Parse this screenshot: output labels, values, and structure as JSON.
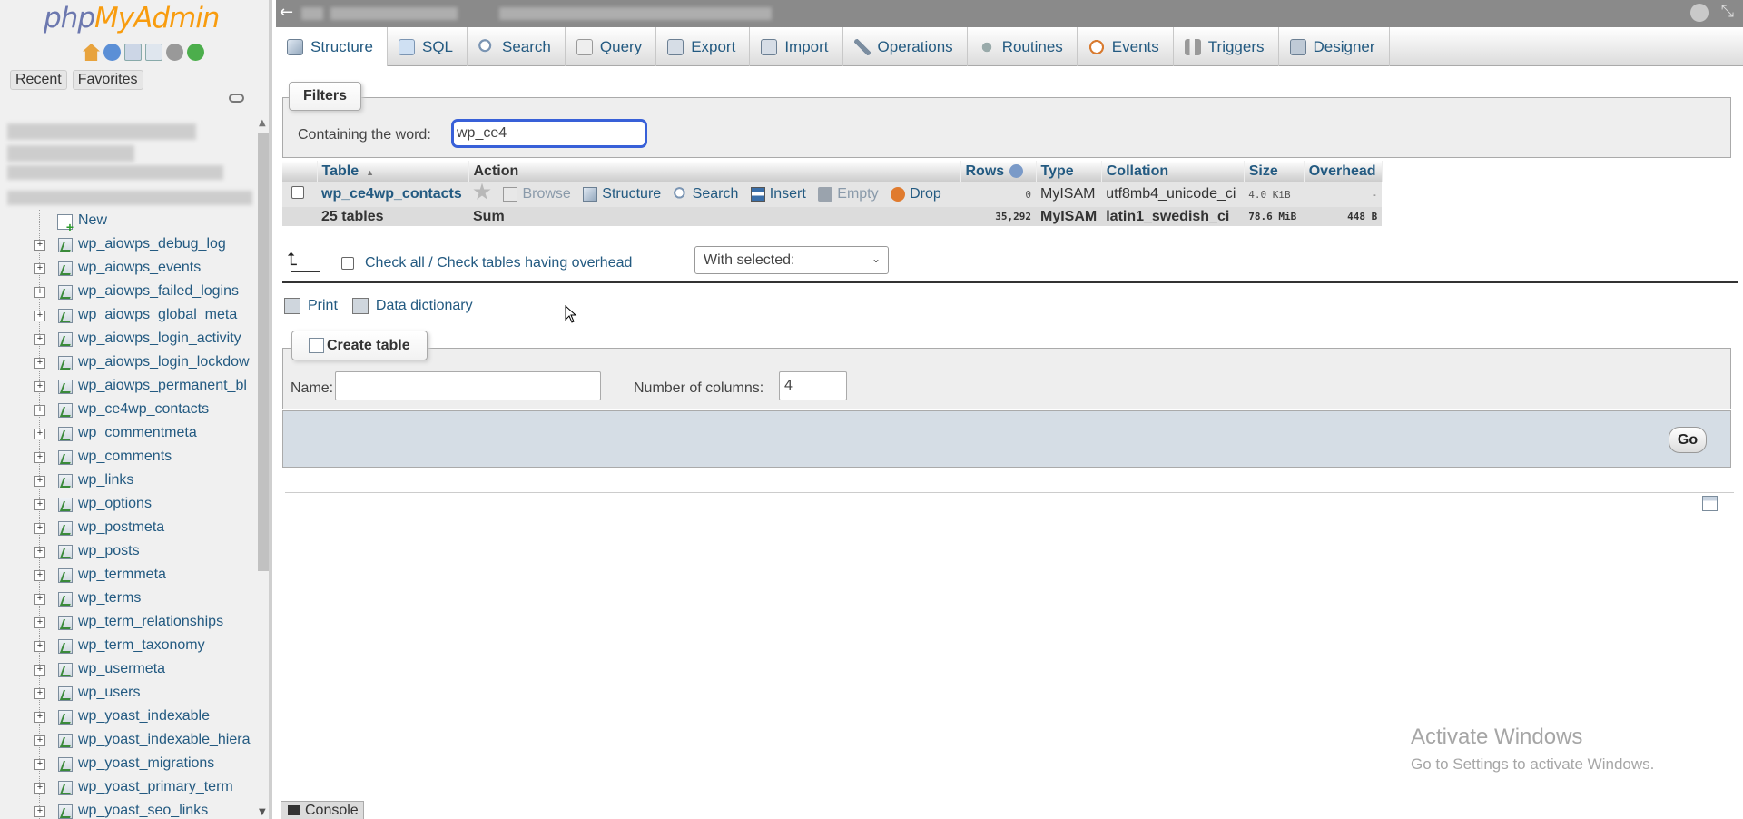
{
  "nav": {
    "logo_php": "php",
    "logo_myadmin": "MyAdmin",
    "recent": "Recent",
    "favorites": "Favorites",
    "new_label": "New",
    "tables": [
      "wp_aiowps_debug_log",
      "wp_aiowps_events",
      "wp_aiowps_failed_logins",
      "wp_aiowps_global_meta",
      "wp_aiowps_login_activity",
      "wp_aiowps_login_lockdow",
      "wp_aiowps_permanent_bl",
      "wp_ce4wp_contacts",
      "wp_commentmeta",
      "wp_comments",
      "wp_links",
      "wp_options",
      "wp_postmeta",
      "wp_posts",
      "wp_termmeta",
      "wp_terms",
      "wp_term_relationships",
      "wp_term_taxonomy",
      "wp_usermeta",
      "wp_users",
      "wp_yoast_indexable",
      "wp_yoast_indexable_hiera",
      "wp_yoast_migrations",
      "wp_yoast_primary_term",
      "wp_yoast_seo_links"
    ]
  },
  "tabs": [
    {
      "label": "Structure",
      "icon": "structure-icon"
    },
    {
      "label": "SQL",
      "icon": "sql-icon"
    },
    {
      "label": "Search",
      "icon": "search-icon"
    },
    {
      "label": "Query",
      "icon": "query-icon"
    },
    {
      "label": "Export",
      "icon": "export-icon"
    },
    {
      "label": "Import",
      "icon": "import-icon"
    },
    {
      "label": "Operations",
      "icon": "operations-icon"
    },
    {
      "label": "Routines",
      "icon": "routines-icon"
    },
    {
      "label": "Events",
      "icon": "events-icon"
    },
    {
      "label": "Triggers",
      "icon": "triggers-icon"
    },
    {
      "label": "Designer",
      "icon": "designer-icon"
    }
  ],
  "filters": {
    "legend": "Filters",
    "label": "Containing the word:",
    "value": "wp_ce4"
  },
  "table": {
    "headers": {
      "table": "Table",
      "action": "Action",
      "rows": "Rows",
      "type": "Type",
      "collation": "Collation",
      "size": "Size",
      "overhead": "Overhead"
    },
    "row": {
      "name": "wp_ce4wp_contacts",
      "actions": {
        "browse": "Browse",
        "structure": "Structure",
        "search": "Search",
        "insert": "Insert",
        "empty": "Empty",
        "drop": "Drop"
      },
      "rows": "0",
      "type": "MyISAM",
      "collation": "utf8mb4_unicode_ci",
      "size": "4.0 KiB",
      "overhead": "-"
    },
    "footer": {
      "count": "25 tables",
      "sum": "Sum",
      "rows": "35,292",
      "type": "MyISAM",
      "collation": "latin1_swedish_ci",
      "size": "78.6 MiB",
      "overhead": "448 B"
    }
  },
  "bulk": {
    "check_all": "Check all / Check tables having overhead",
    "with_selected": "With selected:"
  },
  "links": {
    "print": "Print",
    "data_dictionary": "Data dictionary"
  },
  "create": {
    "legend": "Create table",
    "name_label": "Name:",
    "name_value": "",
    "columns_label": "Number of columns:",
    "columns_value": "4",
    "go": "Go"
  },
  "watermark": {
    "line1": "Activate Windows",
    "line2": "Go to Settings to activate Windows."
  },
  "console": "Console"
}
